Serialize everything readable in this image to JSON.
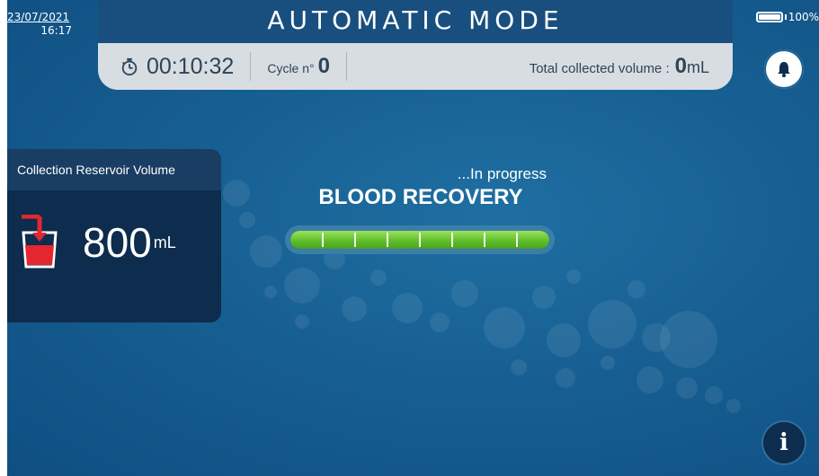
{
  "status_bar": {
    "date": "23/07/2021",
    "time": "16:17",
    "battery_percent": "100%"
  },
  "header": {
    "title": "AUTOMATIC MODE",
    "timer": "00:10:32",
    "cycle_label": "Cycle n°",
    "cycle_value": "0",
    "total_label": "Total collected volume :",
    "total_value": "0",
    "total_unit": "mL"
  },
  "reservoir": {
    "title": "Collection Reservoir Volume",
    "value": "800",
    "unit": "mL"
  },
  "process": {
    "status": "...In progress",
    "name": "BLOOD RECOVERY",
    "progress_fraction": 1.0,
    "segments": 8
  },
  "icons": {
    "stopwatch": "stopwatch-icon",
    "bell": "bell-icon",
    "info": "info-icon",
    "reservoir": "reservoir-icon",
    "battery": "battery-icon"
  },
  "colors": {
    "background": "#175f92",
    "header_bar": "#184f7e",
    "info_bar": "#d8dde1",
    "panel": "#0d2c4e",
    "progress_green": "#5ec02b",
    "reservoir_red": "#e3262f"
  },
  "info_button_label": "i"
}
